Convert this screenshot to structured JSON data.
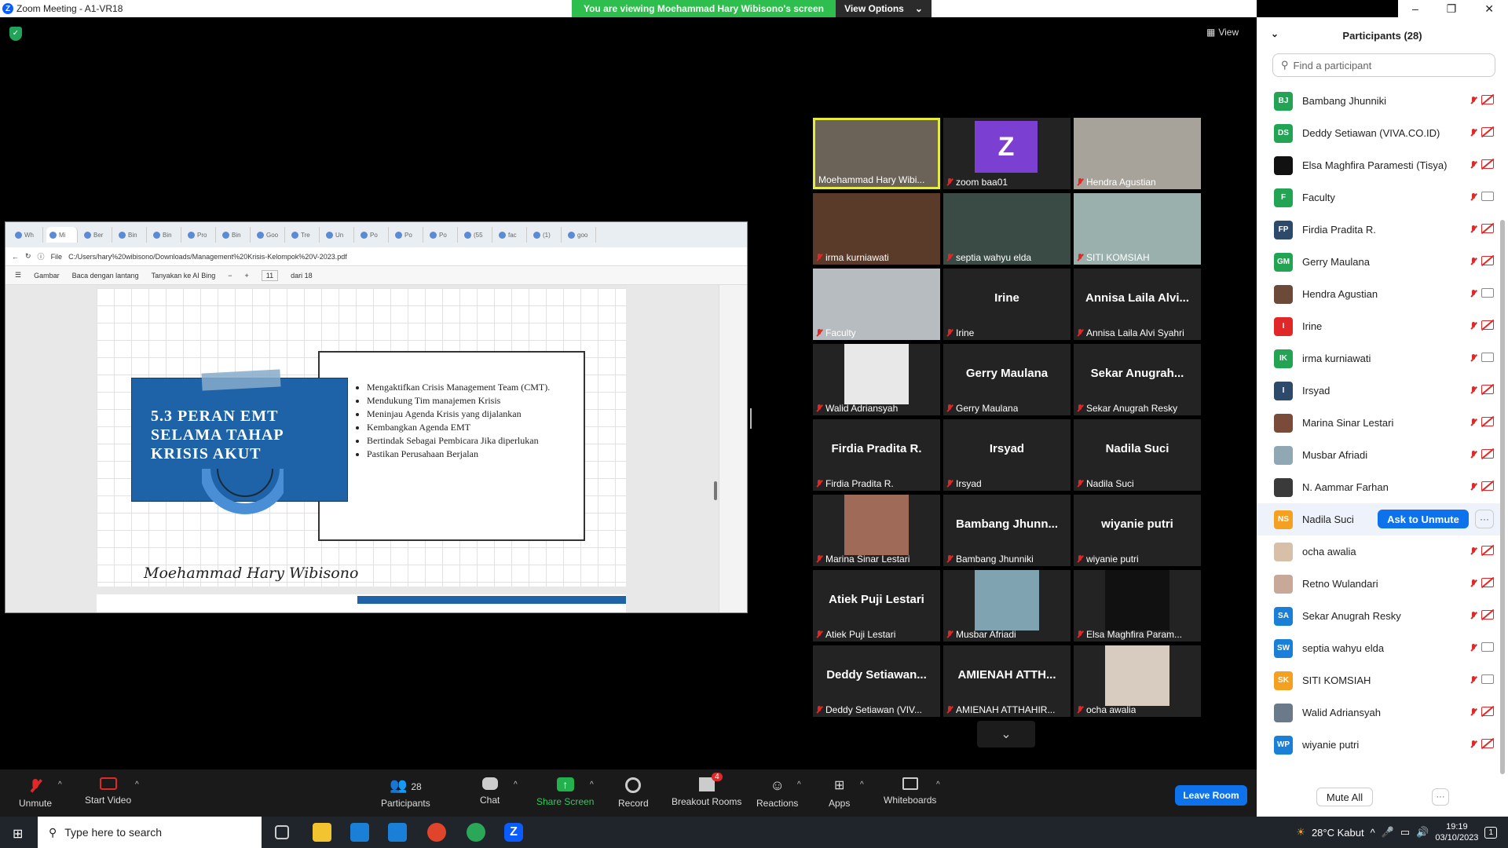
{
  "window": {
    "title": "Zoom Meeting - A1-VR18"
  },
  "banner": {
    "text": "You are viewing Moehammad Hary Wibisono's screen",
    "view_options": "View Options"
  },
  "view_button": "View",
  "shared": {
    "tabs": [
      "Wh",
      "Mi",
      "Ber",
      "Bin",
      "Bin",
      "Pro",
      "Bin",
      "Goo",
      "Tre",
      "Un",
      "Po",
      "Po",
      "Po",
      "(55",
      "fac",
      "(1)",
      "goo"
    ],
    "address_prefix": "File",
    "address": "C:/Users/hary%20wibisono/Downloads/Management%20Krisis-Kelompok%20V-2023.pdf",
    "toolbar": {
      "draw": "Gambar",
      "read_aloud": "Baca dengan lantang",
      "ask_bing": "Tanyakan ke AI Bing",
      "page": "11",
      "page_of": "dari 18"
    },
    "slide": {
      "title_lines": [
        "5.3 PERAN EMT",
        "SELAMA TAHAP",
        "KRISIS AKUT"
      ],
      "bullets": [
        "Mengaktifkan Crisis Management Team (CMT).",
        "Mendukung Tim manajemen Krisis",
        "Meninjau Agenda Krisis yang dijalankan",
        "Kembangkan Agenda EMT",
        "Bertindak Sebagai Pembicara Jika diperlukan",
        "Pastikan Perusahaan Berjalan"
      ],
      "signature": "Moehammad Hary Wibisono"
    }
  },
  "gallery": [
    {
      "name": "Moehammad Hary Wibi...",
      "big": "",
      "video": true,
      "color": "#6b6358",
      "active": true,
      "muted": false
    },
    {
      "name": "zoom baa01",
      "big": "",
      "avatar": "Z",
      "avatar_color": "#7b3fd2",
      "muted": true
    },
    {
      "name": "Hendra Agustian",
      "big": "",
      "video": true,
      "color": "#a8a39a",
      "muted": true
    },
    {
      "name": "irma kurniawati",
      "big": "",
      "video": true,
      "color": "#5a3a28",
      "muted": true
    },
    {
      "name": "septia wahyu elda",
      "big": "",
      "video": true,
      "color": "#3a4a44",
      "muted": true
    },
    {
      "name": "SITI KOMSIAH",
      "big": "",
      "video": true,
      "color": "#9ab0ac",
      "muted": true
    },
    {
      "name": "Faculty",
      "big": "",
      "video": true,
      "color": "#b7bcc0",
      "muted": true
    },
    {
      "name": "Irine",
      "big": "Irine",
      "muted": true
    },
    {
      "name": "Annisa Laila Alvi Syahri",
      "big": "Annisa Laila Alvi...",
      "muted": true
    },
    {
      "name": "Walid Adriansyah",
      "big": "",
      "photo": true,
      "color": "#e8e8e8",
      "muted": true
    },
    {
      "name": "Gerry Maulana",
      "big": "Gerry Maulana",
      "muted": true
    },
    {
      "name": "Sekar Anugrah Resky",
      "big": "Sekar Anugrah...",
      "muted": true
    },
    {
      "name": "Firdia Pradita R.",
      "big": "Firdia Pradita R.",
      "muted": true
    },
    {
      "name": "Irsyad",
      "big": "Irsyad",
      "muted": true
    },
    {
      "name": "Nadila Suci",
      "big": "Nadila Suci",
      "muted": true
    },
    {
      "name": "Marina Sinar Lestari",
      "big": "",
      "photo": true,
      "color": "#a06a58",
      "muted": true
    },
    {
      "name": "Bambang Jhunniki",
      "big": "Bambang Jhunn...",
      "muted": true
    },
    {
      "name": "wiyanie putri",
      "big": "wiyanie putri",
      "muted": true
    },
    {
      "name": "Atiek Puji Lestari",
      "big": "Atiek Puji Lestari",
      "muted": true
    },
    {
      "name": "Musbar Afriadi",
      "big": "",
      "photo": true,
      "color": "#7fa3b0",
      "muted": true
    },
    {
      "name": "Elsa Maghfira Param...",
      "big": "",
      "photo": true,
      "color": "#111",
      "muted": true
    },
    {
      "name": "Deddy Setiawan (VIV...",
      "big": "Deddy Setiawan...",
      "muted": true
    },
    {
      "name": "AMIENAH ATTHAHIR...",
      "big": "AMIENAH ATTH...",
      "muted": true
    },
    {
      "name": "ocha awalia",
      "big": "",
      "photo": true,
      "color": "#d8ccc0",
      "muted": true
    }
  ],
  "toolbar": {
    "unmute": "Unmute",
    "start_video": "Start Video",
    "participants": "Participants",
    "participants_count": "28",
    "chat": "Chat",
    "share_screen": "Share Screen",
    "record": "Record",
    "breakout": "Breakout Rooms",
    "breakout_badge": "4",
    "reactions": "Reactions",
    "apps": "Apps",
    "whiteboards": "Whiteboards",
    "leave": "Leave Room"
  },
  "sidebar": {
    "title": "Participants (28)",
    "search_placeholder": "Find a participant",
    "participants": [
      {
        "initials": "BJ",
        "color": "#23a455",
        "name": "Bambang Jhunniki",
        "video_on": false
      },
      {
        "initials": "DS",
        "color": "#23a455",
        "name": "Deddy Setiawan (VIVA.CO.ID)",
        "video_on": false
      },
      {
        "initials": "",
        "color": "#111111",
        "name": "Elsa Maghfira Paramesti (Tisya)",
        "video_on": false
      },
      {
        "initials": "F",
        "color": "#23a455",
        "name": "Faculty",
        "video_on": true
      },
      {
        "initials": "FP",
        "color": "#2d4a6b",
        "name": "Firdia Pradita R.",
        "video_on": false
      },
      {
        "initials": "GM",
        "color": "#23a455",
        "name": "Gerry Maulana",
        "video_on": false
      },
      {
        "initials": "",
        "color": "#6b4a3a",
        "name": "Hendra Agustian",
        "video_on": true
      },
      {
        "initials": "I",
        "color": "#e02828",
        "name": "Irine",
        "video_on": false
      },
      {
        "initials": "IK",
        "color": "#23a455",
        "name": "irma kurniawati",
        "video_on": true
      },
      {
        "initials": "I",
        "color": "#2d4a6b",
        "name": "Irsyad",
        "video_on": false
      },
      {
        "initials": "",
        "color": "#7a4a3a",
        "name": "Marina Sinar Lestari",
        "video_on": false
      },
      {
        "initials": "",
        "color": "#8fa8b4",
        "name": "Musbar Afriadi",
        "video_on": false
      },
      {
        "initials": "",
        "color": "#3a3a3a",
        "name": "N. Aammar Farhan",
        "video_on": false
      },
      {
        "initials": "NS",
        "color": "#f4a020",
        "name": "Nadila Suci",
        "video_on": false,
        "ask_to_unmute": "Ask to Unmute"
      },
      {
        "initials": "",
        "color": "#d8c0a8",
        "name": "ocha awalia",
        "video_on": false
      },
      {
        "initials": "",
        "color": "#c8a898",
        "name": "Retno Wulandari",
        "video_on": false
      },
      {
        "initials": "SA",
        "color": "#1a7fd6",
        "name": "Sekar Anugrah Resky",
        "video_on": false
      },
      {
        "initials": "SW",
        "color": "#1a7fd6",
        "name": "septia wahyu elda",
        "video_on": true
      },
      {
        "initials": "SK",
        "color": "#f4a020",
        "name": "SITI KOMSIAH",
        "video_on": true
      },
      {
        "initials": "",
        "color": "#6a7a8a",
        "name": "Walid Adriansyah",
        "video_on": false
      },
      {
        "initials": "WP",
        "color": "#1a7fd6",
        "name": "wiyanie putri",
        "video_on": false
      }
    ],
    "mute_all": "Mute All",
    "more": "···"
  },
  "taskbar": {
    "search": "Type here to search",
    "weather": "28°C  Kabut",
    "time": "19:19",
    "date": "03/10/2023",
    "notif": "1"
  }
}
